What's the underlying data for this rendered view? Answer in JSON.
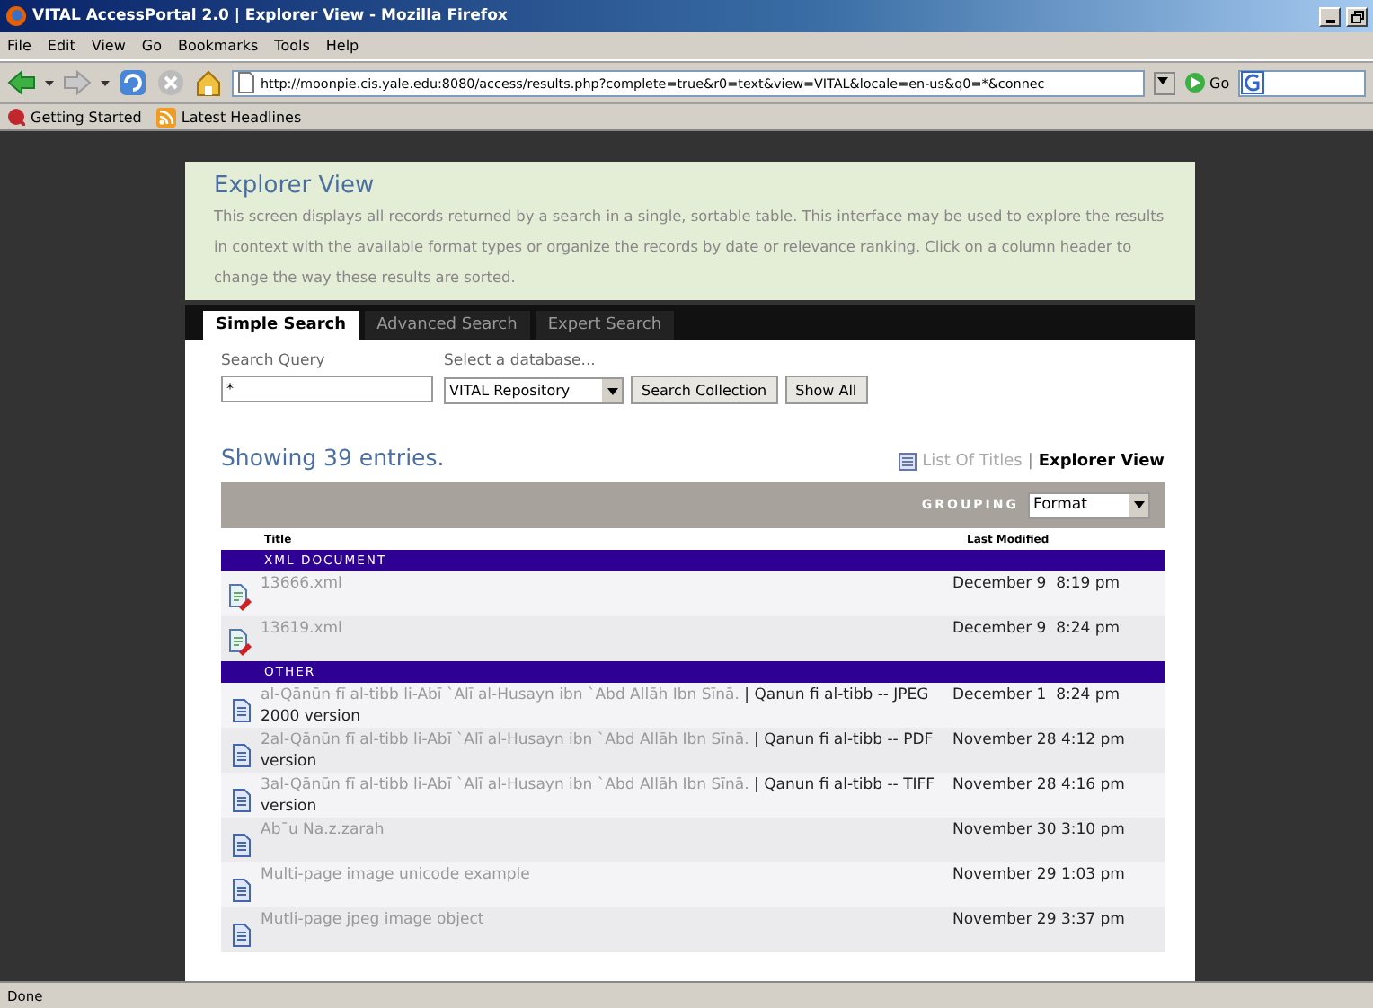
{
  "window": {
    "title": "VITAL AccessPortal 2.0 | Explorer View - Mozilla Firefox"
  },
  "menu": [
    "File",
    "Edit",
    "View",
    "Go",
    "Bookmarks",
    "Tools",
    "Help"
  ],
  "toolbar": {
    "address": "http://moonpie.cis.yale.edu:8080/access/results.php?complete=true&r0=text&view=VITAL&locale=en-us&q0=*&connec",
    "go": "Go"
  },
  "bookmarks": [
    "Getting Started",
    "Latest Headlines"
  ],
  "header": {
    "title": "Explorer View",
    "description": "This screen displays all records returned by a search in a single, sortable table. This interface may be used to explore the results in context with the available format types or organize the records by date or relevance ranking. Click on a column header to change the way these results are sorted."
  },
  "tabs": [
    {
      "label": "Simple Search",
      "selected": true
    },
    {
      "label": "Advanced Search",
      "selected": false
    },
    {
      "label": "Expert Search",
      "selected": false
    }
  ],
  "search": {
    "query_label": "Search Query",
    "query": "*",
    "database_label": "Select a database...",
    "database": "VITAL Repository",
    "buttons": [
      "Search Collection",
      "Show All"
    ]
  },
  "results": {
    "summary": "Showing 39 entries.",
    "views": [
      {
        "label": "List Of Titles",
        "selected": false
      },
      {
        "label": "Explorer View",
        "selected": true
      }
    ],
    "views_separator": "|",
    "grouping_label": "GROUPING",
    "grouping": "Format",
    "columns": [
      "Title",
      "Last Modified"
    ],
    "groups": [
      {
        "name": "XML DOCUMENT",
        "rows": [
          {
            "kind": "xml",
            "title": "13666.xml",
            "modified": "December 9  8:19 pm"
          },
          {
            "kind": "xml",
            "title": "13619.xml",
            "modified": "December 9  8:24 pm"
          }
        ]
      },
      {
        "name": "OTHER",
        "rows": [
          {
            "kind": "doc",
            "title": "al-Qānūn fī al-tibb li-Abī `Alī al-Husayn ibn `Abd Allāh Ibn Sīnā.",
            "subtitle": "| Qanun fi al-tibb -- JPEG 2000 version",
            "modified": "December 1  8:24 pm"
          },
          {
            "kind": "doc",
            "title": "2al-Qānūn fī al-tibb li-Abī `Alī al-Husayn ibn `Abd Allāh Ibn Sīnā.",
            "subtitle": "| Qanun fi al-tibb -- PDF version",
            "modified": "November 28 4:12 pm"
          },
          {
            "kind": "doc",
            "title": "3al-Qānūn fī al-tibb li-Abī `Alī al-Husayn ibn `Abd Allāh Ibn Sīnā.",
            "subtitle": "| Qanun fi al-tibb -- TIFF version",
            "modified": "November 28 4:16 pm"
          },
          {
            "kind": "doc",
            "title": "Ab¯u Na.z.zarah",
            "modified": "November 30 3:10 pm"
          },
          {
            "kind": "doc",
            "title": "Multi-page image unicode example",
            "modified": "November 29 1:03 pm"
          },
          {
            "kind": "doc",
            "title": "Mutli-page jpeg image object",
            "modified": "November 29 3:37 pm"
          }
        ]
      }
    ]
  },
  "status_bar": {
    "text": "Done"
  }
}
